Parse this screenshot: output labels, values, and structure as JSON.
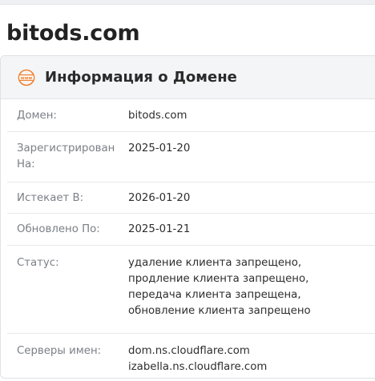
{
  "page": {
    "title": "bitods.com"
  },
  "card": {
    "icon": "www-globe-icon",
    "title": "Информация о Домене",
    "accent_color": "#f0802f",
    "rows": [
      {
        "label": "Домен:",
        "value": [
          "bitods.com"
        ]
      },
      {
        "label": "Зарегистрирован На:",
        "value": [
          "2025-01-20"
        ]
      },
      {
        "label": "Истекает В:",
        "value": [
          "2026-01-20"
        ]
      },
      {
        "label": "Обновлено По:",
        "value": [
          "2025-01-21"
        ]
      },
      {
        "label": "Статус:",
        "value": [
          "удаление клиента запрещено,",
          "продление клиента запрещено,",
          "передача клиента запрещена,",
          "обновление клиента запрещено"
        ]
      },
      {
        "label": "Серверы имен:",
        "value": [
          "dom.ns.cloudflare.com",
          "izabella.ns.cloudflare.com"
        ]
      }
    ]
  }
}
